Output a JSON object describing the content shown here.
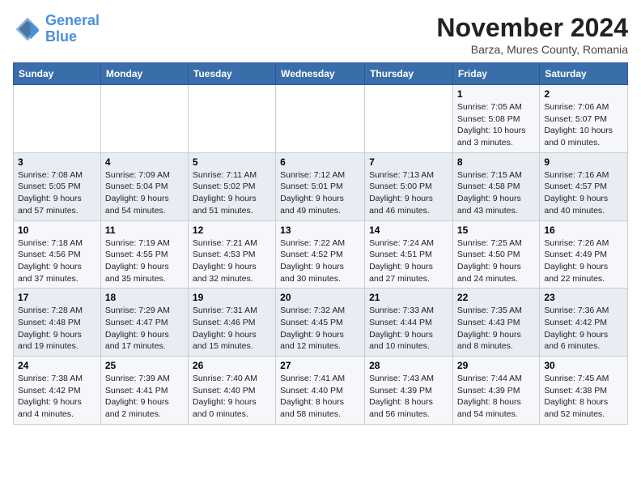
{
  "logo": {
    "line1": "General",
    "line2": "Blue"
  },
  "title": "November 2024",
  "subtitle": "Barza, Mures County, Romania",
  "weekdays": [
    "Sunday",
    "Monday",
    "Tuesday",
    "Wednesday",
    "Thursday",
    "Friday",
    "Saturday"
  ],
  "weeks": [
    [
      {
        "day": "",
        "info": ""
      },
      {
        "day": "",
        "info": ""
      },
      {
        "day": "",
        "info": ""
      },
      {
        "day": "",
        "info": ""
      },
      {
        "day": "",
        "info": ""
      },
      {
        "day": "1",
        "info": "Sunrise: 7:05 AM\nSunset: 5:08 PM\nDaylight: 10 hours\nand 3 minutes."
      },
      {
        "day": "2",
        "info": "Sunrise: 7:06 AM\nSunset: 5:07 PM\nDaylight: 10 hours\nand 0 minutes."
      }
    ],
    [
      {
        "day": "3",
        "info": "Sunrise: 7:08 AM\nSunset: 5:05 PM\nDaylight: 9 hours\nand 57 minutes."
      },
      {
        "day": "4",
        "info": "Sunrise: 7:09 AM\nSunset: 5:04 PM\nDaylight: 9 hours\nand 54 minutes."
      },
      {
        "day": "5",
        "info": "Sunrise: 7:11 AM\nSunset: 5:02 PM\nDaylight: 9 hours\nand 51 minutes."
      },
      {
        "day": "6",
        "info": "Sunrise: 7:12 AM\nSunset: 5:01 PM\nDaylight: 9 hours\nand 49 minutes."
      },
      {
        "day": "7",
        "info": "Sunrise: 7:13 AM\nSunset: 5:00 PM\nDaylight: 9 hours\nand 46 minutes."
      },
      {
        "day": "8",
        "info": "Sunrise: 7:15 AM\nSunset: 4:58 PM\nDaylight: 9 hours\nand 43 minutes."
      },
      {
        "day": "9",
        "info": "Sunrise: 7:16 AM\nSunset: 4:57 PM\nDaylight: 9 hours\nand 40 minutes."
      }
    ],
    [
      {
        "day": "10",
        "info": "Sunrise: 7:18 AM\nSunset: 4:56 PM\nDaylight: 9 hours\nand 37 minutes."
      },
      {
        "day": "11",
        "info": "Sunrise: 7:19 AM\nSunset: 4:55 PM\nDaylight: 9 hours\nand 35 minutes."
      },
      {
        "day": "12",
        "info": "Sunrise: 7:21 AM\nSunset: 4:53 PM\nDaylight: 9 hours\nand 32 minutes."
      },
      {
        "day": "13",
        "info": "Sunrise: 7:22 AM\nSunset: 4:52 PM\nDaylight: 9 hours\nand 30 minutes."
      },
      {
        "day": "14",
        "info": "Sunrise: 7:24 AM\nSunset: 4:51 PM\nDaylight: 9 hours\nand 27 minutes."
      },
      {
        "day": "15",
        "info": "Sunrise: 7:25 AM\nSunset: 4:50 PM\nDaylight: 9 hours\nand 24 minutes."
      },
      {
        "day": "16",
        "info": "Sunrise: 7:26 AM\nSunset: 4:49 PM\nDaylight: 9 hours\nand 22 minutes."
      }
    ],
    [
      {
        "day": "17",
        "info": "Sunrise: 7:28 AM\nSunset: 4:48 PM\nDaylight: 9 hours\nand 19 minutes."
      },
      {
        "day": "18",
        "info": "Sunrise: 7:29 AM\nSunset: 4:47 PM\nDaylight: 9 hours\nand 17 minutes."
      },
      {
        "day": "19",
        "info": "Sunrise: 7:31 AM\nSunset: 4:46 PM\nDaylight: 9 hours\nand 15 minutes."
      },
      {
        "day": "20",
        "info": "Sunrise: 7:32 AM\nSunset: 4:45 PM\nDaylight: 9 hours\nand 12 minutes."
      },
      {
        "day": "21",
        "info": "Sunrise: 7:33 AM\nSunset: 4:44 PM\nDaylight: 9 hours\nand 10 minutes."
      },
      {
        "day": "22",
        "info": "Sunrise: 7:35 AM\nSunset: 4:43 PM\nDaylight: 9 hours\nand 8 minutes."
      },
      {
        "day": "23",
        "info": "Sunrise: 7:36 AM\nSunset: 4:42 PM\nDaylight: 9 hours\nand 6 minutes."
      }
    ],
    [
      {
        "day": "24",
        "info": "Sunrise: 7:38 AM\nSunset: 4:42 PM\nDaylight: 9 hours\nand 4 minutes."
      },
      {
        "day": "25",
        "info": "Sunrise: 7:39 AM\nSunset: 4:41 PM\nDaylight: 9 hours\nand 2 minutes."
      },
      {
        "day": "26",
        "info": "Sunrise: 7:40 AM\nSunset: 4:40 PM\nDaylight: 9 hours\nand 0 minutes."
      },
      {
        "day": "27",
        "info": "Sunrise: 7:41 AM\nSunset: 4:40 PM\nDaylight: 8 hours\nand 58 minutes."
      },
      {
        "day": "28",
        "info": "Sunrise: 7:43 AM\nSunset: 4:39 PM\nDaylight: 8 hours\nand 56 minutes."
      },
      {
        "day": "29",
        "info": "Sunrise: 7:44 AM\nSunset: 4:39 PM\nDaylight: 8 hours\nand 54 minutes."
      },
      {
        "day": "30",
        "info": "Sunrise: 7:45 AM\nSunset: 4:38 PM\nDaylight: 8 hours\nand 52 minutes."
      }
    ]
  ]
}
